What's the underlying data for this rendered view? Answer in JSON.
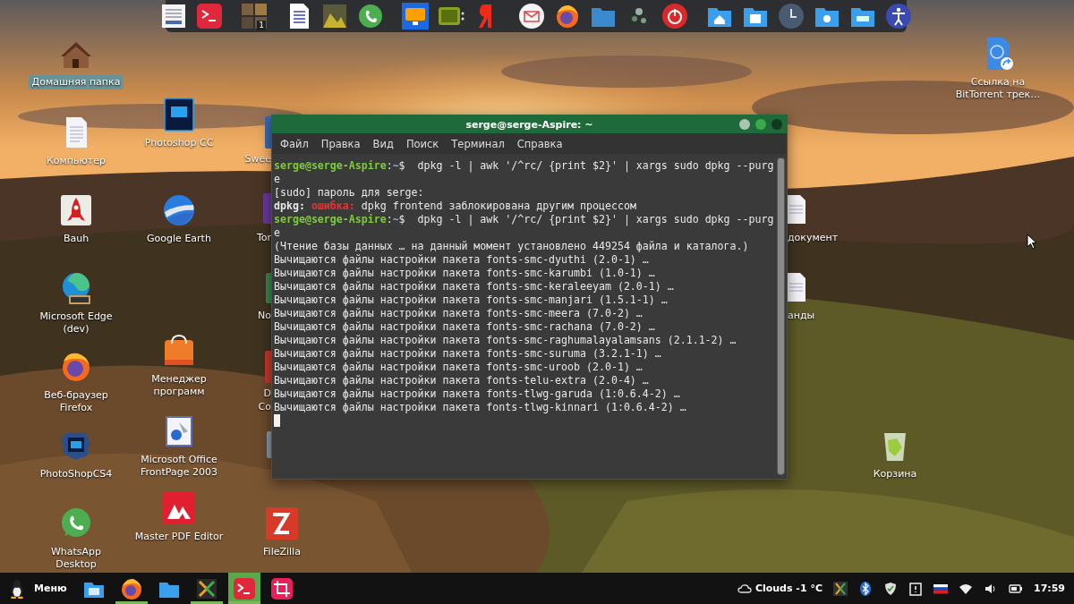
{
  "dock": {
    "badge": "1"
  },
  "desktop": {
    "icons": [
      {
        "kind": "house",
        "label": "Домашняя папка",
        "selected": true
      },
      {
        "kind": "document",
        "label": "Компьютер",
        "selected": false
      },
      {
        "kind": "rocket",
        "label": "Bauh",
        "selected": false
      },
      {
        "kind": "edge",
        "label": "Microsoft Edge\n(dev)",
        "selected": false
      },
      {
        "kind": "firefox",
        "label": "Веб-браузер\nFirefox",
        "selected": false
      },
      {
        "kind": "ps-splash",
        "label": "PhotoShopCS4",
        "selected": false
      },
      {
        "kind": "whatsapp",
        "label": "WhatsApp\nDesktop",
        "selected": false
      },
      {
        "kind": "ps",
        "label": "Photoshop CC",
        "selected": false
      },
      {
        "kind": "earth",
        "label": "Google Earth",
        "selected": false
      },
      {
        "kind": "bag",
        "label": "Менеджер\nпрограмм",
        "selected": false
      },
      {
        "kind": "frontpage",
        "label": "Microsoft Office\nFrontPage 2003",
        "selected": false
      },
      {
        "kind": "pdf",
        "label": "Master PDF Editor",
        "selected": false
      },
      {
        "kind": "filezilla",
        "label": "FileZilla",
        "selected": false
      },
      {
        "kind": "link",
        "label": "Ссылка на\nBitTorrent трек…",
        "selected": false
      },
      {
        "kind": "trash",
        "label": "Корзина",
        "selected": false
      }
    ],
    "clipped_labels": [
      "Swee",
      "Tor",
      "No",
      "D",
      "Co",
      "документ",
      "анды"
    ]
  },
  "terminal": {
    "title": "serge@serge-Aspire: ~",
    "menu": [
      "Файл",
      "Правка",
      "Вид",
      "Поиск",
      "Терминал",
      "Справка"
    ],
    "lines": [
      {
        "kind": "prompt",
        "user": "serge@serge-Aspire",
        "sep": ":",
        "path": "~",
        "symbol": "$",
        "text": "  dpkg -l | awk '/^rc/ {print $2}' | xargs sudo dpkg --purg"
      },
      {
        "kind": "plain",
        "text": "e"
      },
      {
        "kind": "plain",
        "text": "[sudo] пароль для serge:"
      },
      {
        "kind": "error",
        "source": "dpkg:",
        "label": "ошибка:",
        "text": " dpkg frontend заблокирована другим процессом"
      },
      {
        "kind": "prompt",
        "user": "serge@serge-Aspire",
        "sep": ":",
        "path": "~",
        "symbol": "$",
        "text": "  dpkg -l | awk '/^rc/ {print $2}' | xargs sudo dpkg --purg"
      },
      {
        "kind": "plain",
        "text": "e"
      },
      {
        "kind": "plain",
        "text": "(Чтение базы данных … на данный момент установлено 449254 файла и каталога.)"
      },
      {
        "kind": "plain",
        "text": "Вычищаются файлы настройки пакета fonts-smc-dyuthi (2.0-1) …"
      },
      {
        "kind": "plain",
        "text": "Вычищаются файлы настройки пакета fonts-smc-karumbi (1.0-1) …"
      },
      {
        "kind": "plain",
        "text": "Вычищаются файлы настройки пакета fonts-smc-keraleeyam (2.0-1) …"
      },
      {
        "kind": "plain",
        "text": "Вычищаются файлы настройки пакета fonts-smc-manjari (1.5.1-1) …"
      },
      {
        "kind": "plain",
        "text": "Вычищаются файлы настройки пакета fonts-smc-meera (7.0-2) …"
      },
      {
        "kind": "plain",
        "text": "Вычищаются файлы настройки пакета fonts-smc-rachana (7.0-2) …"
      },
      {
        "kind": "plain",
        "text": "Вычищаются файлы настройки пакета fonts-smc-raghumalayalamsans (2.1.1-2) …"
      },
      {
        "kind": "plain",
        "text": "Вычищаются файлы настройки пакета fonts-smc-suruma (3.2.1-1) …"
      },
      {
        "kind": "plain",
        "text": "Вычищаются файлы настройки пакета fonts-smc-uroob (2.0-1) …"
      },
      {
        "kind": "plain",
        "text": "Вычищаются файлы настройки пакета fonts-telu-extra (2.0-4) …"
      },
      {
        "kind": "plain",
        "text": "Вычищаются файлы настройки пакета fonts-tlwg-garuda (1:0.6.4-2) …"
      },
      {
        "kind": "plain",
        "text": "Вычищаются файлы настройки пакета fonts-tlwg-kinnari (1:0.6.4-2) …"
      }
    ],
    "cursor": true
  },
  "taskbar": {
    "menu_label": "Меню",
    "apps": [
      {
        "kind": "files",
        "running": false,
        "selected": false
      },
      {
        "kind": "firefox",
        "running": true,
        "selected": false
      },
      {
        "kind": "folder",
        "running": false,
        "selected": false
      },
      {
        "kind": "kde",
        "running": true,
        "selected": false
      },
      {
        "kind": "terminal",
        "running": true,
        "selected": true
      },
      {
        "kind": "crop",
        "running": false,
        "selected": false
      }
    ],
    "weather": "Clouds -1 °C",
    "clock": "17:59"
  }
}
